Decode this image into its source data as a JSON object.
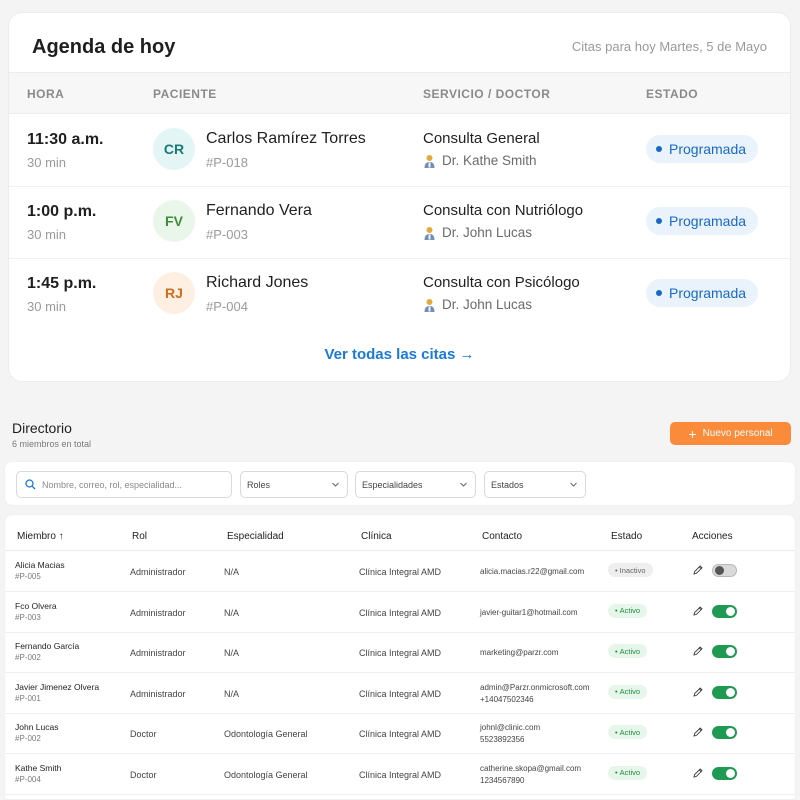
{
  "agenda": {
    "title": "Agenda de hoy",
    "subtitle": "Citas para hoy Martes, 5 de Mayo",
    "columns": [
      "HORA",
      "PACIENTE",
      "SERVICIO / DOCTOR",
      "ESTADO"
    ],
    "appointments": [
      {
        "time": "11:30 a.m.",
        "duration": "30 min",
        "initials": "CR",
        "avatar_bg": "#e3f5f5",
        "avatar_fg": "#197a78",
        "patient": "Carlos Ramírez Torres",
        "patient_id": "#P-018",
        "service": "Consulta General",
        "doctor": "Dr. Kathe Smith",
        "status": "Programada"
      },
      {
        "time": "1:00 p.m.",
        "duration": "30 min",
        "initials": "FV",
        "avatar_bg": "#eaf6ea",
        "avatar_fg": "#3e8c3a",
        "patient": "Fernando Vera",
        "patient_id": "#P-003",
        "service": "Consulta con Nutriólogo",
        "doctor": "Dr. John Lucas",
        "status": "Programada"
      },
      {
        "time": "1:45 p.m.",
        "duration": "30 min",
        "initials": "RJ",
        "avatar_bg": "#fdf0e2",
        "avatar_fg": "#cf6d1c",
        "patient": "Richard Jones",
        "patient_id": "#P-004",
        "service": "Consulta con Psicólogo",
        "doctor": "Dr. John Lucas",
        "status": "Programada"
      }
    ],
    "view_all": "Ver todas las citas →"
  },
  "directory": {
    "title": "Directorio",
    "subtitle": "6 miembros en total",
    "new_button": "Nuevo personal",
    "search_placeholder": "Nombre, correo, rol, especialidad...",
    "filters": [
      "Roles",
      "Especialidades",
      "Estados"
    ],
    "columns": [
      "Miembro ↑",
      "Rol",
      "Especialidad",
      "Clínica",
      "Contacto",
      "Estado",
      "Acciones"
    ],
    "members": [
      {
        "name": "Alicia Macias",
        "id": "#P-005",
        "role": "Administrador",
        "specialty": "N/A",
        "clinic": "Clínica Integral AMD",
        "contact": [
          "alicia.macias.r22@gmail.com"
        ],
        "status": "Inactivo",
        "active": false
      },
      {
        "name": "Fco Olvera",
        "id": "#P-003",
        "role": "Administrador",
        "specialty": "N/A",
        "clinic": "Clínica Integral AMD",
        "contact": [
          "javier-guitar1@hotmail.com"
        ],
        "status": "Activo",
        "active": true
      },
      {
        "name": "Fernando García",
        "id": "#P-002",
        "role": "Administrador",
        "specialty": "N/A",
        "clinic": "Clínica Integral AMD",
        "contact": [
          "marketing@parzr.com"
        ],
        "status": "Activo",
        "active": true
      },
      {
        "name": "Javier Jimenez Olvera",
        "id": "#P-001",
        "role": "Administrador",
        "specialty": "N/A",
        "clinic": "Clínica Integral AMD",
        "contact": [
          "admin@Parzr.onmicrosoft.com",
          "+14047502346"
        ],
        "status": "Activo",
        "active": true
      },
      {
        "name": "John Lucas",
        "id": "#P-002",
        "role": "Doctor",
        "specialty": "Odontología General",
        "clinic": "Clínica Integral AMD",
        "contact": [
          "johnl@clinic.com",
          "5523892356"
        ],
        "status": "Activo",
        "active": true
      },
      {
        "name": "Kathe Smith",
        "id": "#P-004",
        "role": "Doctor",
        "specialty": "Odontología General",
        "clinic": "Clínica Integral AMD",
        "contact": [
          "catherine.skopa@gmail.com",
          "1234567890"
        ],
        "status": "Activo",
        "active": true
      }
    ]
  },
  "colors": {
    "accent_blue": "#1a7ad6",
    "accent_orange": "#f98b3a",
    "active_green": "#1f9a53"
  }
}
